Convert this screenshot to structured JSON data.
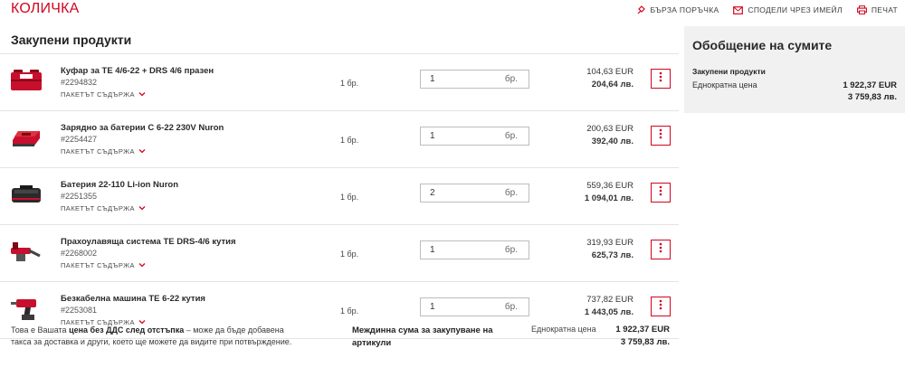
{
  "header": {
    "title": "КОЛИЧКА",
    "actions": [
      {
        "label": "БЪРЗА ПОРЪЧКА",
        "icon": "quick-order-icon"
      },
      {
        "label": "СПОДЕЛИ ЧРЕЗ ИМЕЙЛ",
        "icon": "mail-icon"
      },
      {
        "label": "ПЕЧАТ",
        "icon": "print-icon"
      }
    ]
  },
  "section": {
    "title": "Закупени продукти"
  },
  "products": [
    {
      "name": "Куфар за TE 4/6-22 + DRS 4/6 празен",
      "code": "#2294832",
      "pack_label": "ПАКЕТЪТ СЪДЪРЖА",
      "unit": "1 бр.",
      "qty": "1",
      "qty_unit": "бр.",
      "price_eur": "104,63 EUR",
      "price_lv": "204,64 лв.",
      "thumb": "toolcase-icon"
    },
    {
      "name": "Зарядно за батерии C 6-22 230V Nuron",
      "code": "#2254427",
      "pack_label": "ПАКЕТЪТ СЪДЪРЖА",
      "unit": "1 бр.",
      "qty": "1",
      "qty_unit": "бр.",
      "price_eur": "200,63 EUR",
      "price_lv": "392,40 лв.",
      "thumb": "charger-icon"
    },
    {
      "name": "Батерия 22-110 Li-ion Nuron",
      "code": "#2251355",
      "pack_label": "ПАКЕТЪТ СЪДЪРЖА",
      "unit": "1 бр.",
      "qty": "2",
      "qty_unit": "бр.",
      "price_eur": "559,36 EUR",
      "price_lv": "1 094,01 лв.",
      "thumb": "battery-icon"
    },
    {
      "name": "Прахоулавяща система TE DRS-4/6 кутия",
      "code": "#2268002",
      "pack_label": "ПАКЕТЪТ СЪДЪРЖА",
      "unit": "1 бр.",
      "qty": "1",
      "qty_unit": "бр.",
      "price_eur": "319,93 EUR",
      "price_lv": "625,73 лв.",
      "thumb": "dust-system-icon"
    },
    {
      "name": "Безкабелна машина TE 6-22 кутия",
      "code": "#2253081",
      "pack_label": "ПАКЕТЪТ СЪДЪРЖА",
      "unit": "1 бр.",
      "qty": "1",
      "qty_unit": "бр.",
      "price_eur": "737,82 EUR",
      "price_lv": "1 443,05 лв.",
      "thumb": "rotary-hammer-icon"
    }
  ],
  "footer": {
    "note_pre": "Това е Вашата ",
    "note_bold": "цена без ДДС след отстъпка",
    "note_post": " – може да бъде добавена такса за доставка и други, което ще можете да видите при потвърждение.",
    "subtotal_label": "Междинна сума за закупуване на артикули",
    "kind_label": "Еднократна цена",
    "total_eur": "1 922,37 EUR",
    "total_lv": "3 759,83 лв."
  },
  "summary": {
    "title": "Обобщение на сумите",
    "sub_label": "Закупени продукти",
    "kind_label": "Еднократна цена",
    "total_eur": "1 922,37 EUR",
    "total_lv": "3 759,83 лв."
  },
  "colors": {
    "accent": "#d2051e",
    "panel": "#f1f1f1",
    "divider": "#e3e3e3"
  }
}
